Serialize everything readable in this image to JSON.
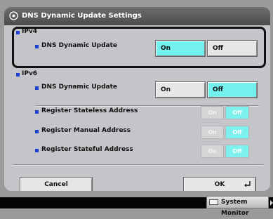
{
  "title": "DNS Dynamic Update Settings",
  "ipv4": {
    "section_label": "IPv4",
    "dns_label": "DNS Dynamic Update",
    "on_label": "On",
    "off_label": "Off",
    "selected": "On"
  },
  "ipv6": {
    "section_label": "IPv6",
    "dns_label": "DNS Dynamic Update",
    "on_label": "On",
    "off_label": "Off",
    "selected": "Off",
    "options": [
      {
        "label": "Register Stateless Address",
        "on": "On",
        "off": "Off",
        "selected": "Off"
      },
      {
        "label": "Register Manual Address",
        "on": "On",
        "off": "Off",
        "selected": "Off"
      },
      {
        "label": "Register Stateful Address",
        "on": "On",
        "off": "Off",
        "selected": "Off"
      }
    ]
  },
  "actions": {
    "cancel_label": "Cancel",
    "ok_label": "OK"
  },
  "status_bar": {
    "system_monitor_label": "System Monitor"
  },
  "colors": {
    "selected_button": "#74f1ee",
    "bullet": "#1e3fd4",
    "title_bar": "#555555"
  }
}
